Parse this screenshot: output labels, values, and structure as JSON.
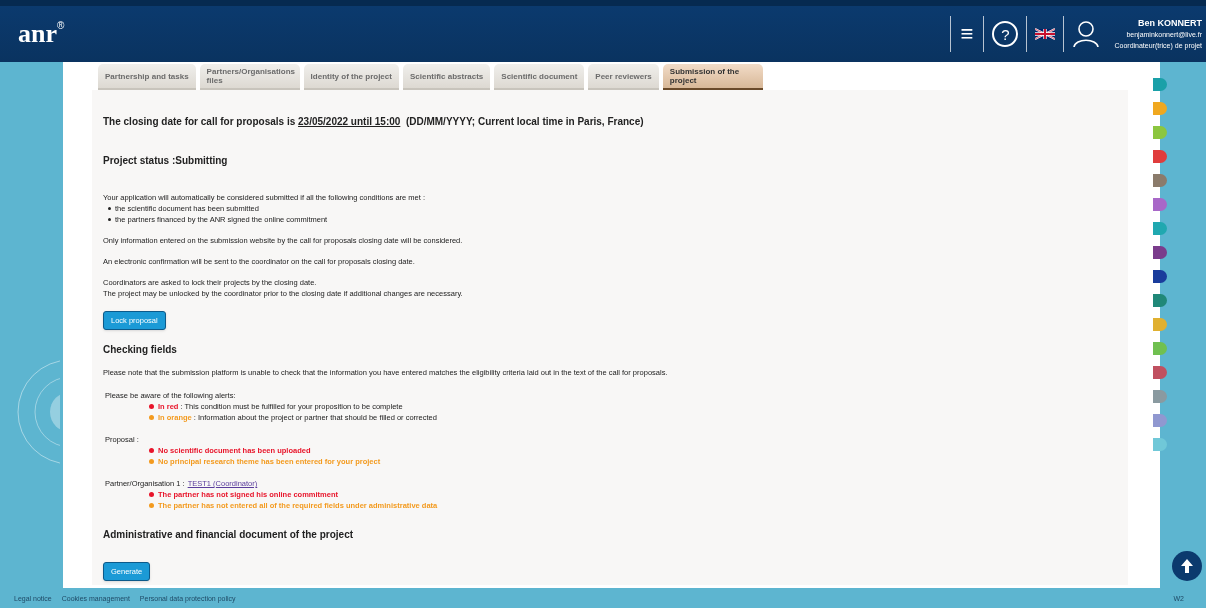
{
  "header": {
    "logo": "anr",
    "logo_mark": "®",
    "menu_icon": "≡",
    "help_icon": "?",
    "user": {
      "name": "Ben KONNERT",
      "email": "benjaminkonnert@live.fr",
      "role": "Coordinateur(trice) de projet"
    }
  },
  "tabs": [
    {
      "label": "Partnership and tasks",
      "selected": false
    },
    {
      "label": "Partners/Organisations files",
      "selected": false
    },
    {
      "label": "Identity of the project",
      "selected": false
    },
    {
      "label": "Scientific abstracts",
      "selected": false
    },
    {
      "label": "Scientific document",
      "selected": false
    },
    {
      "label": "Peer reviewers",
      "selected": false
    },
    {
      "label": "Submission of the project",
      "selected": true
    }
  ],
  "closing": {
    "prefix": "The closing date for call for proposals is",
    "date": "23/05/2022 until 15:00",
    "suffix": "(DD/MM/YYYY; Current local time in Paris, France)"
  },
  "status_title": "Project status :Submitting",
  "intro": "Your application will automatically be considered submitted if all the following conditions are met :",
  "conditions": [
    "the scientific document has been submitted",
    "the partners financed by the ANR signed the online commitment"
  ],
  "paragraphs": [
    [
      "Only information entered on the submission website by the call for proposals closing date will be considered."
    ],
    [
      "An electronic confirmation will be sent to the coordinator on the call for proposals closing date."
    ],
    [
      "Coordinators are asked to lock their projects by the closing date.",
      "The project may be unlocked by the coordinator prior to the closing date if additional changes are necessary."
    ]
  ],
  "lock_button": "Lock proposal",
  "checking_title": "Checking fields",
  "checking_note": "Please note that the submission platform is unable to check that the information you have entered matches the eligibility criteria laid out in the text of the call for proposals.",
  "legend_title": "Please be aware of the following alerts:",
  "legend": [
    {
      "color": "#e8142a",
      "key": "In red",
      "text": " : This condition must be fulfilled for your proposition to be complete"
    },
    {
      "color": "#f39a1e",
      "key": "In orange",
      "text": " : Information about the project or partner that should be filled or corrected"
    }
  ],
  "alert_groups": [
    {
      "label": "Proposal :",
      "alerts": [
        {
          "color": "#e8142a",
          "text": "No scientific document has been uploaded"
        },
        {
          "color": "#f39a1e",
          "text": "No principal research theme has been entered for your project"
        }
      ]
    },
    {
      "label": "Partner/Organisation 1 :",
      "link": "TEST1 (Coordinator)",
      "alerts": [
        {
          "color": "#e8142a",
          "text": "The partner has not signed his online commitment"
        },
        {
          "color": "#f39a1e",
          "text": "The partner has not entered all of the required fields under administrative data"
        }
      ]
    }
  ],
  "admin_title": "Administrative and financial document of the project",
  "generate_button": "Generate",
  "side_tabs": [
    {
      "color": "#1aa0a8"
    },
    {
      "color": "#f0a820"
    },
    {
      "color": "#8cc63f"
    },
    {
      "color": "#e03c3c"
    },
    {
      "color": "#8b7b6b"
    },
    {
      "color": "#a868c8"
    },
    {
      "color": "#20a8b0"
    },
    {
      "color": "#7a3c8c"
    },
    {
      "color": "#1a3c9c"
    },
    {
      "color": "#208878"
    },
    {
      "color": "#e0b030"
    },
    {
      "color": "#70c050"
    },
    {
      "color": "#c05060"
    },
    {
      "color": "#8a9aa0"
    },
    {
      "color": "#9098d0"
    },
    {
      "color": "#70c8d8"
    }
  ],
  "footer": {
    "links": [
      "Legal notice",
      "Cookies management",
      "Personal data protection policy"
    ],
    "version": "W2"
  }
}
